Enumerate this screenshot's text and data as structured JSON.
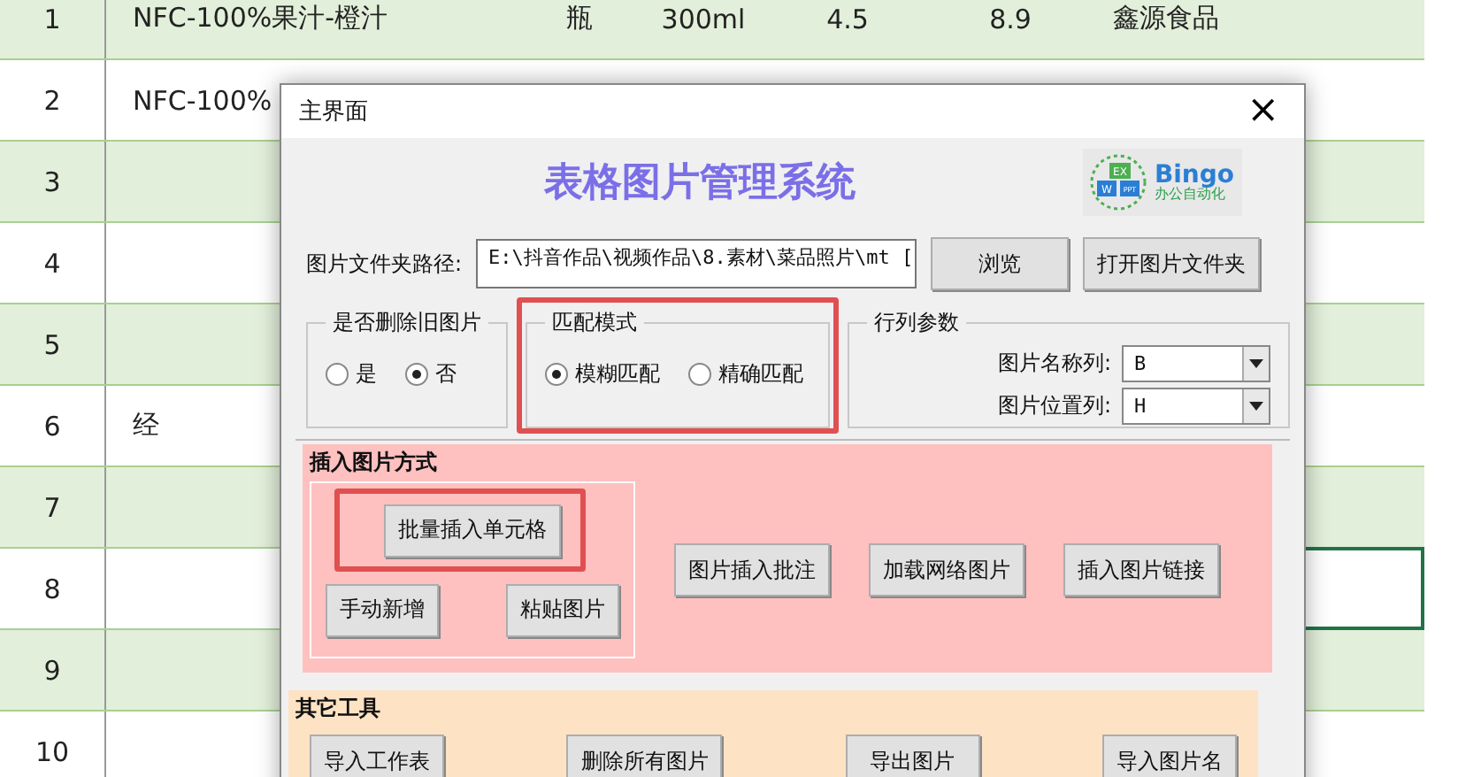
{
  "sheet": {
    "rows": [
      {
        "number": "1",
        "cells": [
          "NFC-100%果汁-橙汁",
          "瓶",
          "300ml",
          "4.5",
          "8.9",
          "鑫源食品"
        ],
        "selected": false
      },
      {
        "number": "2",
        "cells": [
          "NFC-100%"
        ],
        "selected": false
      },
      {
        "number": "3",
        "cells": [],
        "selected": false
      },
      {
        "number": "4",
        "cells": [],
        "selected": false
      },
      {
        "number": "5",
        "cells": [],
        "selected": false
      },
      {
        "number": "6",
        "cells": [
          "经"
        ],
        "selected": false
      },
      {
        "number": "7",
        "cells": [],
        "selected": false
      },
      {
        "number": "8",
        "cells": [],
        "selected": true
      },
      {
        "number": "9",
        "cells": [],
        "selected": false
      },
      {
        "number": "10",
        "cells": [],
        "selected": false
      }
    ]
  },
  "dialog": {
    "title": "主界面",
    "close": "×",
    "heading": "表格图片管理系统",
    "logo": {
      "name": "Bingo",
      "tagline": "办公自动化",
      "badges": [
        "EX",
        "W",
        "PPT"
      ]
    },
    "folder": {
      "label": "图片文件夹路径:",
      "value": "E:\\抖音作品\\视频作品\\8.素材\\菜品照片\\mt [",
      "buttons": [
        "浏览",
        "打开图片文件夹"
      ]
    },
    "delete_old": {
      "title": "是否删除旧图片",
      "options": [
        {
          "label": "是",
          "selected": false
        },
        {
          "label": "否",
          "selected": true
        }
      ]
    },
    "match_mode": {
      "title": "匹配模式",
      "highlighted": true,
      "options": [
        {
          "label": "模糊匹配",
          "selected": true
        },
        {
          "label": "精确匹配",
          "selected": false
        }
      ]
    },
    "row_col": {
      "title": "行列参数",
      "fields": [
        {
          "label": "图片名称列:",
          "value": "B"
        },
        {
          "label": "图片位置列:",
          "value": "H"
        }
      ]
    },
    "insert": {
      "title": "插入图片方式",
      "group_buttons": [
        {
          "label": "批量插入单元格",
          "highlighted": true
        },
        {
          "label": "手动新增",
          "highlighted": false
        },
        {
          "label": "粘贴图片",
          "highlighted": false
        }
      ],
      "buttons": [
        "图片插入批注",
        "加载网络图片",
        "插入图片链接"
      ]
    },
    "tools": {
      "title": "其它工具",
      "buttons": [
        "导入工作表",
        "删除所有图片",
        "导出图片",
        "导入图片名"
      ]
    }
  }
}
